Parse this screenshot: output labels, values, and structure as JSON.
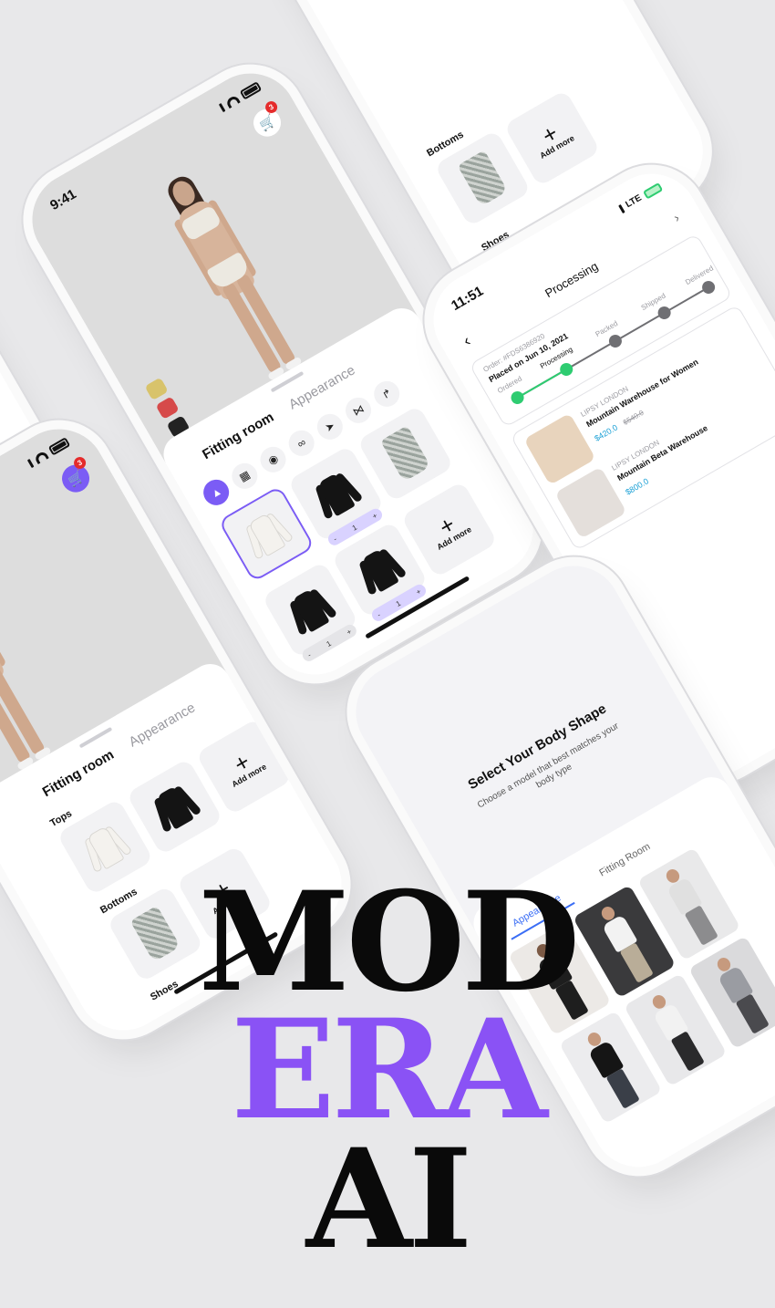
{
  "brand": {
    "line1": "MOD",
    "line2": "ERA",
    "line3": "AI"
  },
  "phone_top": {
    "section_bottoms": "Bottoms",
    "add_more": "Add more",
    "section_shoes": "Shoes"
  },
  "phone_fitting": {
    "time": "9:41",
    "cart_count": "3",
    "tab_fitting": "Fitting room",
    "tab_appearance": "Appearance",
    "swatch_colors": [
      "#d8c36b",
      "#d64a4a",
      "#222222"
    ],
    "add_more": "Add more",
    "stepper_minus": "-",
    "stepper_value": "1",
    "stepper_plus": "+"
  },
  "phone_left": {
    "cart_count": "3",
    "tab_fitting": "Fitting room",
    "tab_appearance": "Appearance",
    "section_tops": "Tops",
    "section_bottoms": "Bottoms",
    "section_shoes": "Shoes",
    "add_more": "Add more"
  },
  "phone_order": {
    "time": "11:51",
    "network": "LTE",
    "title": "Processing",
    "order_label": "Order: #FDS6386920",
    "placed_on": "Placed on Jun 10, 2021",
    "steps": [
      "Ordered",
      "Processing",
      "Packed",
      "Shipped",
      "Delivered"
    ],
    "items": [
      {
        "brand": "LIPSY LONDON",
        "name": "Mountain Warehouse for Women",
        "price": "$420.0",
        "old_price": "$540.0"
      },
      {
        "brand": "LIPSY LONDON",
        "name": "Mountain Beta Warehouse",
        "price": "$800.0"
      }
    ],
    "status_color_done": "#2ecc71",
    "status_color_pending": "#6f6f73"
  },
  "phone_body": {
    "title": "Select Your Body Shape",
    "subtitle": "Choose a model that best matches your body type",
    "tab_appearance": "Appearance",
    "tab_fitting": "Fitting Room",
    "accent": "#3b6ef5"
  }
}
